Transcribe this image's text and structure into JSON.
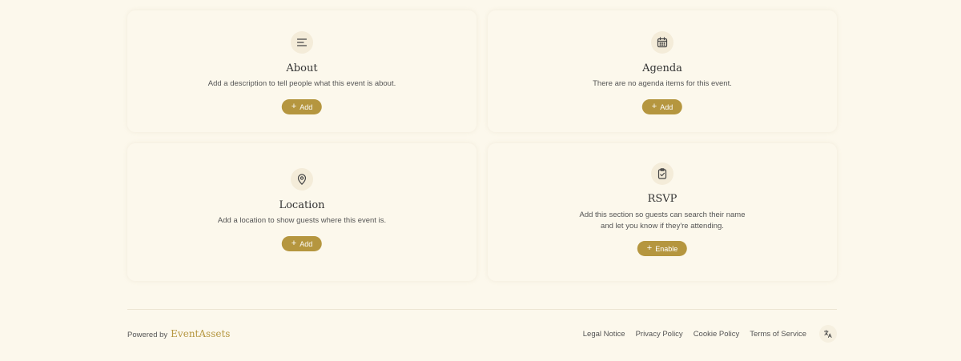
{
  "sections": {
    "about": {
      "title": "About",
      "description": "Add a description to tell people what this event is about.",
      "button_label": "Add",
      "icon": "text-align-left-icon"
    },
    "agenda": {
      "title": "Agenda",
      "description": "There are no agenda items for this event.",
      "button_label": "Add",
      "icon": "calendar-icon"
    },
    "location": {
      "title": "Location",
      "description": "Add a location to show guests where this event is.",
      "button_label": "Add",
      "icon": "map-pin-icon"
    },
    "rsvp": {
      "title": "RSVP",
      "description": "Add this section so guests can search their name and let you know if they're attending.",
      "button_label": "Enable",
      "icon": "clipboard-check-icon"
    }
  },
  "footer": {
    "powered_by": "Powered by",
    "brand": "EventAssets",
    "links": [
      "Legal Notice",
      "Privacy Policy",
      "Cookie Policy",
      "Terms of Service"
    ],
    "language_icon": "translate-icon"
  },
  "colors": {
    "background": "#fcf8ec",
    "accent": "#b5963f",
    "icon_bg": "#f4ecd9"
  }
}
